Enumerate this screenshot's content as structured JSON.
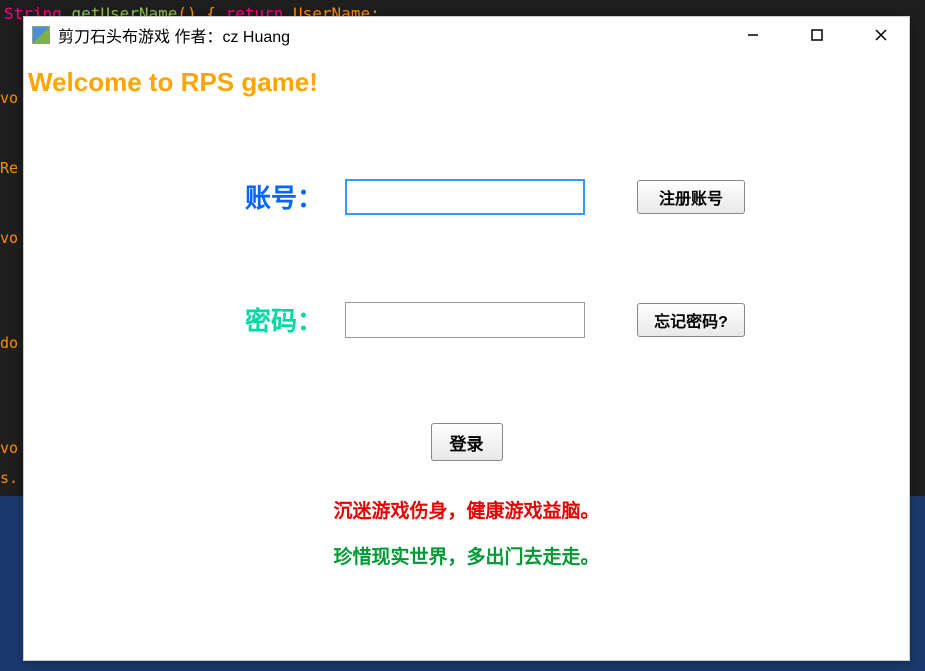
{
  "code_bg": {
    "line1_parts": [
      "String",
      " ",
      "getUserName",
      "()",
      " { ",
      "return",
      " ",
      "UserName",
      ";"
    ],
    "side_vo": "vo",
    "side_re": "Re",
    "side_do": "do",
    "side_s": "s."
  },
  "window": {
    "title": "剪刀石头布游戏  作者：cz Huang",
    "welcome": "Welcome to RPS game!",
    "account_label": "账号：",
    "password_label": "密码：",
    "account_value": "",
    "password_value": "",
    "register_button": "注册账号",
    "forgot_button": "忘记密码?",
    "login_button": "登录",
    "warning_red": "沉迷游戏伤身，健康游戏益脑。",
    "warning_green": "珍惜现实世界，多出门去走走。"
  },
  "watermark": ""
}
